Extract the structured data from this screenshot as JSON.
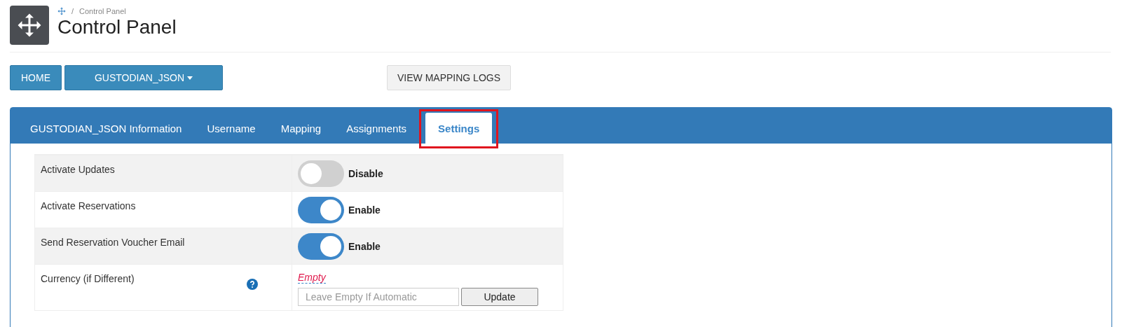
{
  "breadcrumb": {
    "separator": "/",
    "current": "Control Panel"
  },
  "page_title": "Control Panel",
  "nav_buttons": [
    {
      "label": "HOME",
      "kind": "plain"
    },
    {
      "label": "GUSTODIAN_JSON",
      "kind": "dropdown"
    }
  ],
  "logs_button": "VIEW MAPPING LOGS",
  "tabs": [
    {
      "label": "GUSTODIAN_JSON Information",
      "selected": false,
      "highlighted": false
    },
    {
      "label": "Username",
      "selected": false,
      "highlighted": false
    },
    {
      "label": "Mapping",
      "selected": false,
      "highlighted": false
    },
    {
      "label": "Assignments",
      "selected": false,
      "highlighted": false
    },
    {
      "label": "Settings",
      "selected": true,
      "highlighted": true
    }
  ],
  "settings": [
    {
      "kind": "toggle",
      "label": "Activate Updates",
      "on": false,
      "state_label": "Disable"
    },
    {
      "kind": "toggle",
      "label": "Activate Reservations",
      "on": true,
      "state_label": "Enable"
    },
    {
      "kind": "toggle",
      "label": "Send Reservation Voucher Email",
      "on": true,
      "state_label": "Enable"
    },
    {
      "kind": "text",
      "label": "Currency (if Different)",
      "help": true,
      "value": "Empty",
      "placeholder": "Leave Empty If Automatic",
      "button": "Update"
    }
  ]
}
